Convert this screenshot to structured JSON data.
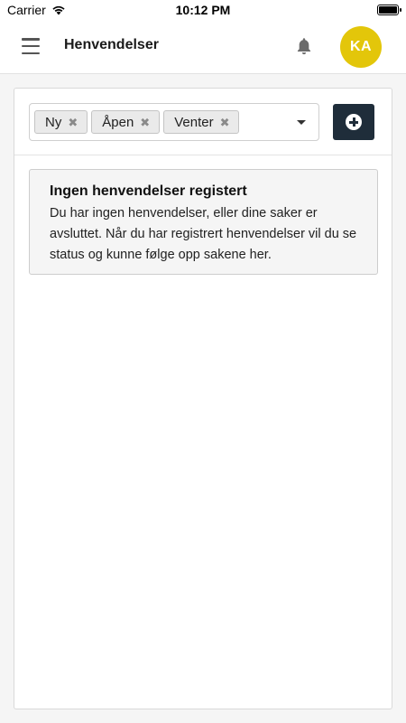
{
  "status_bar": {
    "carrier": "Carrier",
    "time": "10:12 PM",
    "wifi_icon": "wifi-icon",
    "battery_icon": "battery-icon"
  },
  "header": {
    "title": "Henvendelser",
    "menu_icon": "hamburger-menu-icon",
    "bell_icon": "bell-icon",
    "avatar_initials": "KA",
    "avatar_color": "#e3c60a"
  },
  "filters": {
    "chips": [
      {
        "label": "Ny"
      },
      {
        "label": "Åpen"
      },
      {
        "label": "Venter"
      }
    ],
    "remove_icon": "close-icon",
    "dropdown_icon": "caret-down-icon",
    "add_icon": "plus-circle-icon",
    "add_button_color": "#1f2d3a"
  },
  "empty_state": {
    "title": "Ingen henvendelser registert",
    "text": "Du har ingen henvendelser, eller dine saker er avsluttet. Når du har registrert henvendelser vil du se status og kunne følge opp sakene her."
  }
}
